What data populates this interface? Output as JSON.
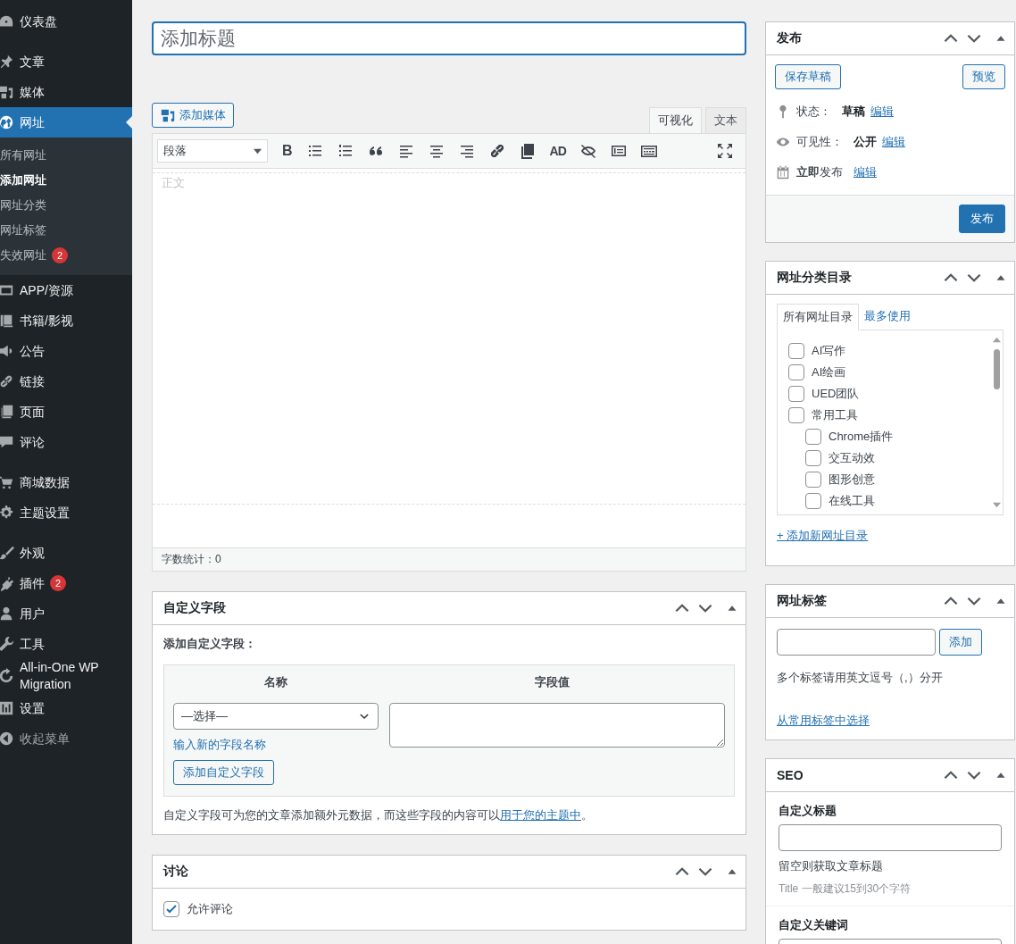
{
  "sidebar": {
    "groups": [
      {
        "items": [
          {
            "label": "仪表盘",
            "selected": false
          }
        ]
      },
      {
        "items": [
          {
            "label": "文章",
            "selected": false
          },
          {
            "label": "媒体",
            "selected": false
          },
          {
            "label": "网址",
            "selected": true,
            "children": [
              {
                "label": "所有网址",
                "selected": false
              },
              {
                "label": "添加网址",
                "selected": true
              },
              {
                "label": "网址分类",
                "selected": false
              },
              {
                "label": "网址标签",
                "selected": false
              },
              {
                "label": "失效网址",
                "selected": false,
                "badge": "2"
              }
            ]
          },
          {
            "label": "APP/资源",
            "selected": false
          },
          {
            "label": "书籍/影视",
            "selected": false
          },
          {
            "label": "公告",
            "selected": false
          },
          {
            "label": "链接",
            "selected": false
          },
          {
            "label": "页面",
            "selected": false
          },
          {
            "label": "评论",
            "selected": false
          }
        ]
      },
      {
        "items": [
          {
            "label": "商城数据",
            "selected": false
          },
          {
            "label": "主题设置",
            "selected": false
          }
        ]
      },
      {
        "items": [
          {
            "label": "外观",
            "selected": false
          },
          {
            "label": "插件",
            "selected": false,
            "badge": "2"
          },
          {
            "label": "用户",
            "selected": false
          },
          {
            "label": "工具",
            "selected": false
          },
          {
            "label": "All-in-One WP Migration",
            "selected": false
          },
          {
            "label": "设置",
            "selected": false
          },
          {
            "label": "收起菜单",
            "selected": false
          }
        ]
      }
    ]
  },
  "editor": {
    "title_placeholder": "添加标题",
    "add_media": "添加媒体",
    "tabs": [
      {
        "label": "可视化",
        "selected": true
      },
      {
        "label": "文本",
        "selected": false
      }
    ],
    "format": "段落",
    "bold_label": "B",
    "ad_label": "AD",
    "body_placeholder": "正文",
    "word_count": "字数统计：0"
  },
  "custom_fields": {
    "title": "自定义字段",
    "subtitle": "添加自定义字段：",
    "columns": [
      "名称",
      "字段值"
    ],
    "select": "—选择—",
    "new_name_link": "输入新的字段名称",
    "add_button": "添加自定义字段",
    "note": "自定义字段可为您的文章添加额外元数据，而这些字段的内容可以",
    "note_link": "用于您的主题中",
    "note_end": "。"
  },
  "discussion": {
    "title": "讨论",
    "options": [
      {
        "label": "允许评论",
        "checked": true
      }
    ]
  },
  "publish": {
    "title": "发布",
    "save_draft": "保存草稿",
    "preview": "预览",
    "rows": [
      {
        "label": "状态：",
        "value": "草稿",
        "link": "编辑"
      },
      {
        "label": "可见性：",
        "value": "公开",
        "link": "编辑"
      },
      {
        "label": "**立即**发布",
        "link": "编辑"
      }
    ],
    "publish_button": "发布"
  },
  "categories": {
    "title": "网址分类目录",
    "tabs": [
      {
        "label": "所有网址目录",
        "selected": true
      },
      {
        "label": "最多使用",
        "selected": false
      }
    ],
    "items": [
      {
        "label": "AI写作",
        "checked": false
      },
      {
        "label": "AI绘画",
        "checked": false
      },
      {
        "label": "UED团队",
        "checked": false
      },
      {
        "label": "常用工具",
        "checked": false,
        "children": [
          {
            "label": "Chrome插件",
            "checked": false
          },
          {
            "label": "交互动效",
            "checked": false
          },
          {
            "label": "图形创意",
            "checked": false
          },
          {
            "label": "在线工具",
            "checked": false
          }
        ]
      }
    ],
    "add_link": "+ 添加新网址目录"
  },
  "tags": {
    "title": "网址标签",
    "add_button": "添加",
    "hint": "多个标签请用英文逗号（,）分开",
    "choose_link": "从常用标签中选择"
  },
  "seo": {
    "title": "SEO",
    "fields": [
      {
        "label": "自定义标题",
        "hint": "留空则获取文章标题",
        "note": "Title 一般建议15到30个字符"
      },
      {
        "label": "自定义关键词"
      }
    ]
  }
}
